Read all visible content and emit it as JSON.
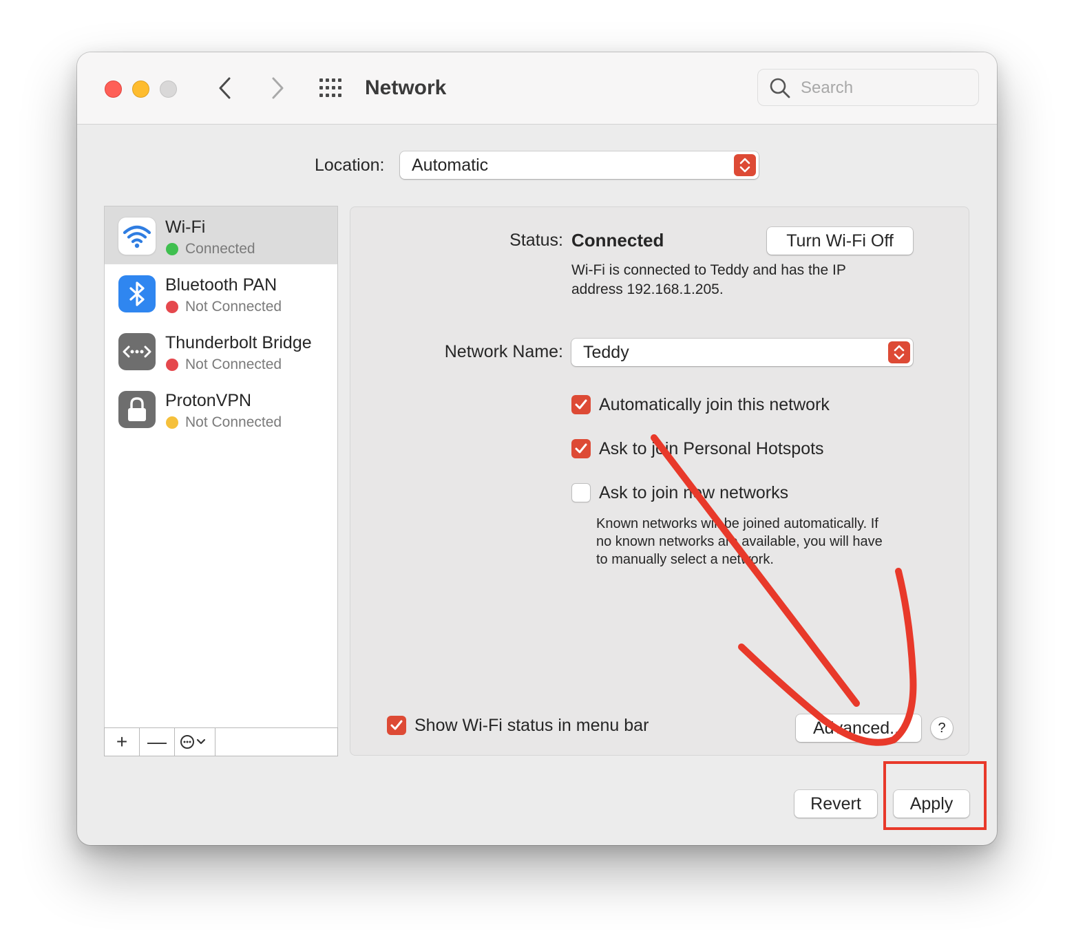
{
  "window": {
    "title": "Network",
    "search_placeholder": "Search"
  },
  "location": {
    "label": "Location:",
    "value": "Automatic"
  },
  "services": [
    {
      "name": "Wi-Fi",
      "status": "Connected",
      "status_color": "#3fbf4f",
      "icon": "wifi-icon",
      "selected": true
    },
    {
      "name": "Bluetooth PAN",
      "status": "Not Connected",
      "status_color": "#e5484d",
      "icon": "bluetooth-icon"
    },
    {
      "name": "Thunderbolt Bridge",
      "status": "Not Connected",
      "status_color": "#e5484d",
      "icon": "thunderbolt-bridge-icon"
    },
    {
      "name": "ProtonVPN",
      "status": "Not Connected",
      "status_color": "#f5c03b",
      "icon": "lock-icon"
    }
  ],
  "sidebar_controls": {
    "add": "+",
    "remove": "—"
  },
  "detail": {
    "status_label": "Status:",
    "status_value": "Connected",
    "turn_off_button": "Turn Wi-Fi Off",
    "status_desc_line1": "Wi-Fi is connected to Teddy and has the IP",
    "status_desc_line2": "address 192.168.1.205.",
    "network_name_label": "Network Name:",
    "network_name_value": "Teddy",
    "checkboxes": [
      {
        "label": "Automatically join this network",
        "checked": true
      },
      {
        "label": "Ask to join Personal Hotspots",
        "checked": true
      },
      {
        "label": "Ask to join new networks",
        "checked": false
      }
    ],
    "new_networks_desc_line1": "Known networks will be joined automatically. If",
    "new_networks_desc_line2": "no known networks are available, you will have",
    "new_networks_desc_line3": "to manually select a network.",
    "show_status_label": "Show Wi-Fi status in menu bar",
    "show_status_checked": true,
    "advanced_button": "Advanced...",
    "help_button": "?"
  },
  "footer": {
    "revert_button": "Revert",
    "apply_button": "Apply"
  },
  "colors": {
    "accent": "#dd4a35",
    "annotation": "#e8392a"
  }
}
